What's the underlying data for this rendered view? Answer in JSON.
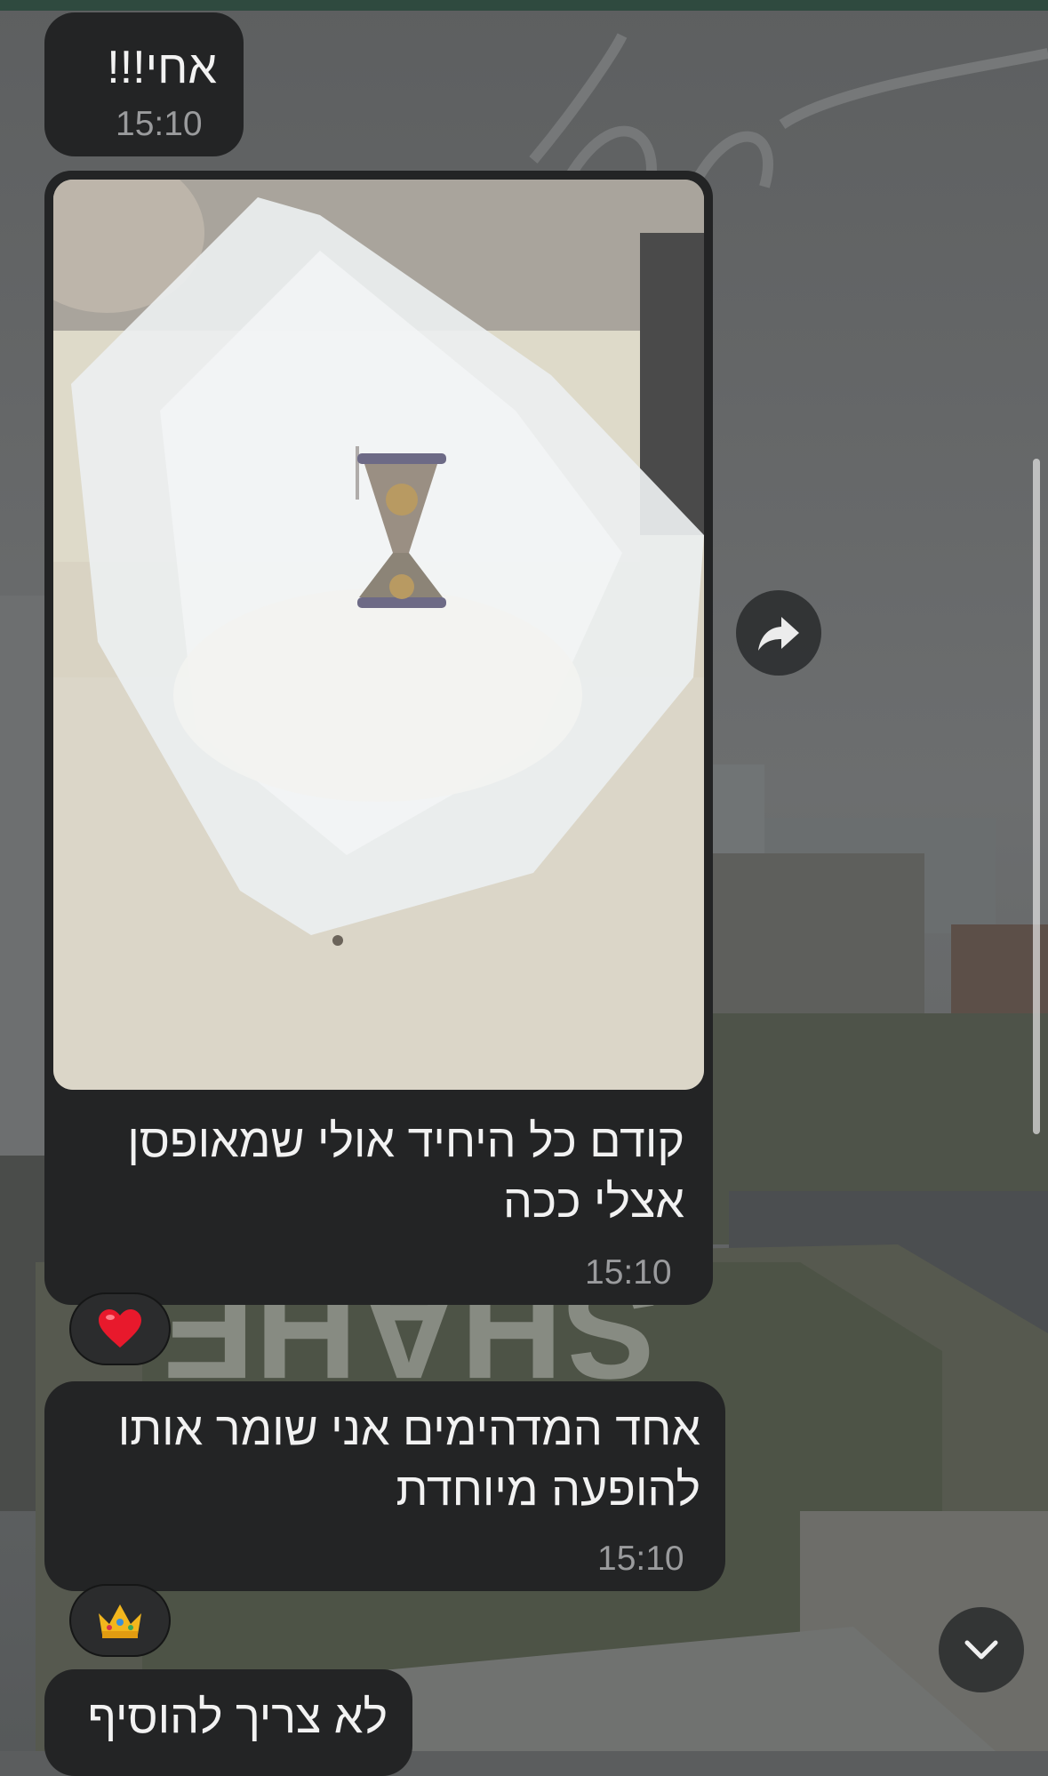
{
  "messages": [
    {
      "text": "אחי!!!",
      "time": "15:10"
    },
    {
      "text": "קודם כל היחיד אולי שמאופסן\nאצלי ככה",
      "time": "15:10",
      "has_photo": true,
      "reaction": "❤️"
    },
    {
      "text": "אחד המדהימים אני שומר אותו\nלהופעה מיוחדת",
      "time": "15:10",
      "reaction": "👑"
    },
    {
      "text": "לא צריך להוסיף"
    }
  ],
  "buttons": {
    "forward_icon": "forward-arrow-icon",
    "scroll_down_icon": "chevron-down-icon"
  },
  "colors": {
    "bubble": "#232425",
    "time_text": "#9a9b9d",
    "top_bar": "#2f4a3f"
  }
}
